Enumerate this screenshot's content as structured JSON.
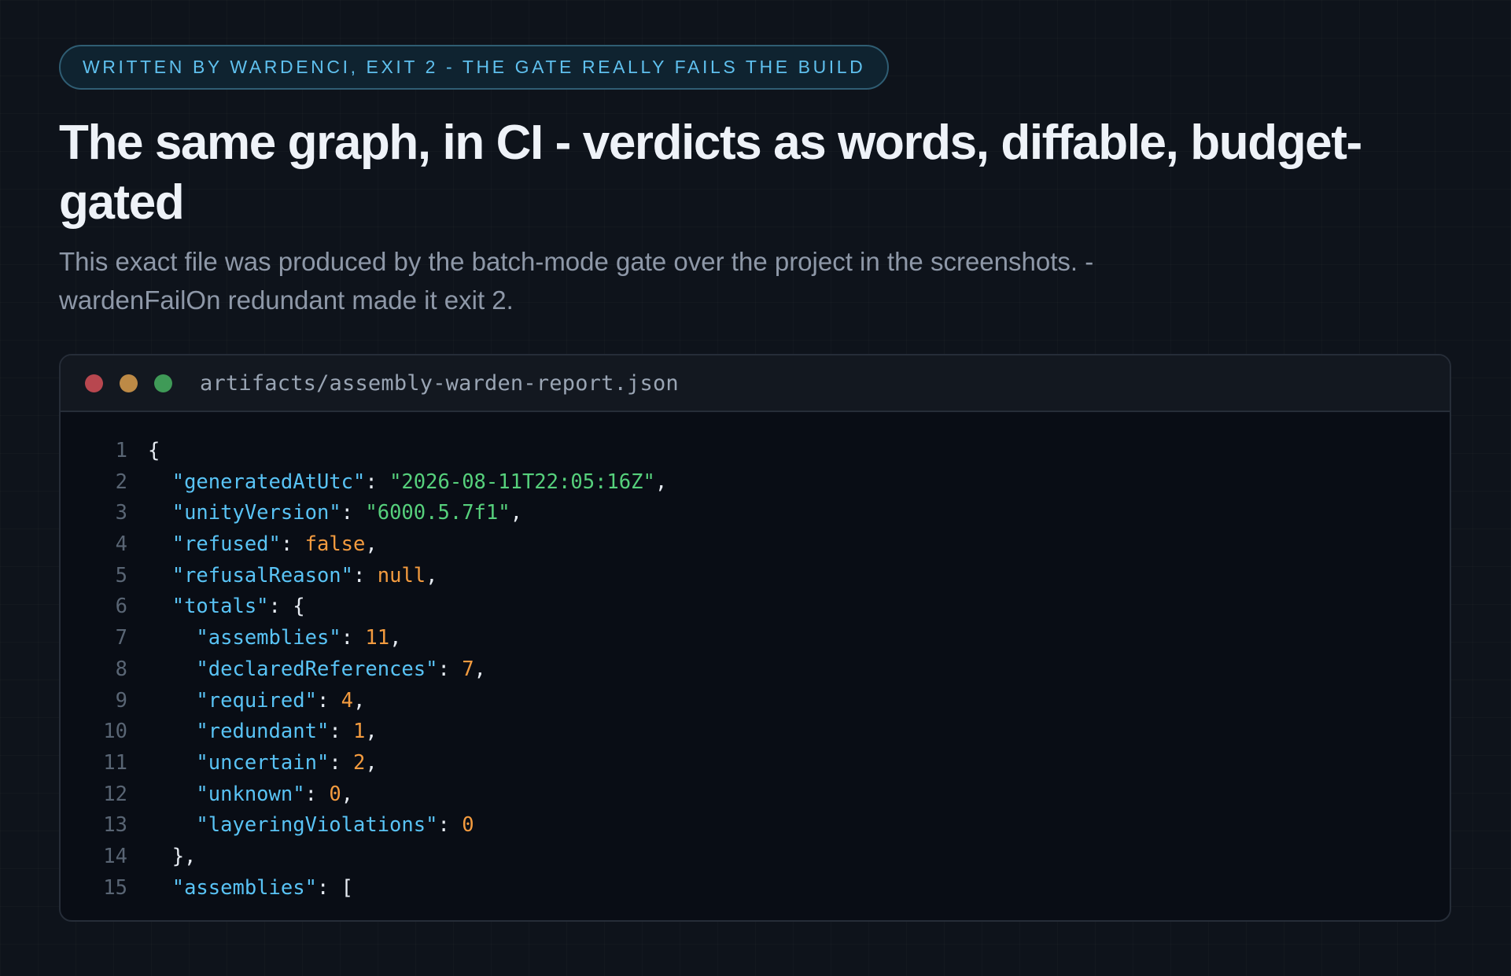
{
  "eyebrow": "WRITTEN BY WARDENCI, EXIT 2 - THE GATE REALLY FAILS THE BUILD",
  "title": "The same graph, in CI - verdicts as words, diffable, budget-gated",
  "subtitle": "This exact file was produced by the batch-mode gate over the project in the screenshots. -wardenFailOn redundant made it exit 2.",
  "code_window": {
    "filename": "artifacts/assembly-warden-report.json",
    "window_controls": [
      "close-dot",
      "minimize-dot",
      "maximize-dot"
    ],
    "colors": {
      "close": "#b8474f",
      "minimize": "#bd8a46",
      "maximize": "#3f9a57",
      "key": "#59c3f5",
      "string": "#56d07c",
      "number": "#f39b3f"
    },
    "lines": [
      {
        "number": "1",
        "tokens": [
          {
            "t": "p",
            "v": "{"
          }
        ]
      },
      {
        "number": "2",
        "tokens": [
          {
            "t": "p",
            "v": "  "
          },
          {
            "t": "k",
            "v": "\"generatedAtUtc\""
          },
          {
            "t": "p",
            "v": ": "
          },
          {
            "t": "s",
            "v": "\"2026-08-11T22:05:16Z\""
          },
          {
            "t": "p",
            "v": ","
          }
        ]
      },
      {
        "number": "3",
        "tokens": [
          {
            "t": "p",
            "v": "  "
          },
          {
            "t": "k",
            "v": "\"unityVersion\""
          },
          {
            "t": "p",
            "v": ": "
          },
          {
            "t": "s",
            "v": "\"6000.5.7f1\""
          },
          {
            "t": "p",
            "v": ","
          }
        ]
      },
      {
        "number": "4",
        "tokens": [
          {
            "t": "p",
            "v": "  "
          },
          {
            "t": "k",
            "v": "\"refused\""
          },
          {
            "t": "p",
            "v": ": "
          },
          {
            "t": "n",
            "v": "false"
          },
          {
            "t": "p",
            "v": ","
          }
        ]
      },
      {
        "number": "5",
        "tokens": [
          {
            "t": "p",
            "v": "  "
          },
          {
            "t": "k",
            "v": "\"refusalReason\""
          },
          {
            "t": "p",
            "v": ": "
          },
          {
            "t": "n",
            "v": "null"
          },
          {
            "t": "p",
            "v": ","
          }
        ]
      },
      {
        "number": "6",
        "tokens": [
          {
            "t": "p",
            "v": "  "
          },
          {
            "t": "k",
            "v": "\"totals\""
          },
          {
            "t": "p",
            "v": ": {"
          }
        ]
      },
      {
        "number": "7",
        "tokens": [
          {
            "t": "p",
            "v": "    "
          },
          {
            "t": "k",
            "v": "\"assemblies\""
          },
          {
            "t": "p",
            "v": ": "
          },
          {
            "t": "n",
            "v": "11"
          },
          {
            "t": "p",
            "v": ","
          }
        ]
      },
      {
        "number": "8",
        "tokens": [
          {
            "t": "p",
            "v": "    "
          },
          {
            "t": "k",
            "v": "\"declaredReferences\""
          },
          {
            "t": "p",
            "v": ": "
          },
          {
            "t": "n",
            "v": "7"
          },
          {
            "t": "p",
            "v": ","
          }
        ]
      },
      {
        "number": "9",
        "tokens": [
          {
            "t": "p",
            "v": "    "
          },
          {
            "t": "k",
            "v": "\"required\""
          },
          {
            "t": "p",
            "v": ": "
          },
          {
            "t": "n",
            "v": "4"
          },
          {
            "t": "p",
            "v": ","
          }
        ]
      },
      {
        "number": "10",
        "tokens": [
          {
            "t": "p",
            "v": "    "
          },
          {
            "t": "k",
            "v": "\"redundant\""
          },
          {
            "t": "p",
            "v": ": "
          },
          {
            "t": "n",
            "v": "1"
          },
          {
            "t": "p",
            "v": ","
          }
        ]
      },
      {
        "number": "11",
        "tokens": [
          {
            "t": "p",
            "v": "    "
          },
          {
            "t": "k",
            "v": "\"uncertain\""
          },
          {
            "t": "p",
            "v": ": "
          },
          {
            "t": "n",
            "v": "2"
          },
          {
            "t": "p",
            "v": ","
          }
        ]
      },
      {
        "number": "12",
        "tokens": [
          {
            "t": "p",
            "v": "    "
          },
          {
            "t": "k",
            "v": "\"unknown\""
          },
          {
            "t": "p",
            "v": ": "
          },
          {
            "t": "n",
            "v": "0"
          },
          {
            "t": "p",
            "v": ","
          }
        ]
      },
      {
        "number": "13",
        "tokens": [
          {
            "t": "p",
            "v": "    "
          },
          {
            "t": "k",
            "v": "\"layeringViolations\""
          },
          {
            "t": "p",
            "v": ": "
          },
          {
            "t": "n",
            "v": "0"
          }
        ]
      },
      {
        "number": "14",
        "tokens": [
          {
            "t": "p",
            "v": "  },"
          }
        ]
      },
      {
        "number": "15",
        "tokens": [
          {
            "t": "p",
            "v": "  "
          },
          {
            "t": "k",
            "v": "\"assemblies\""
          },
          {
            "t": "p",
            "v": ": ["
          }
        ]
      }
    ]
  }
}
